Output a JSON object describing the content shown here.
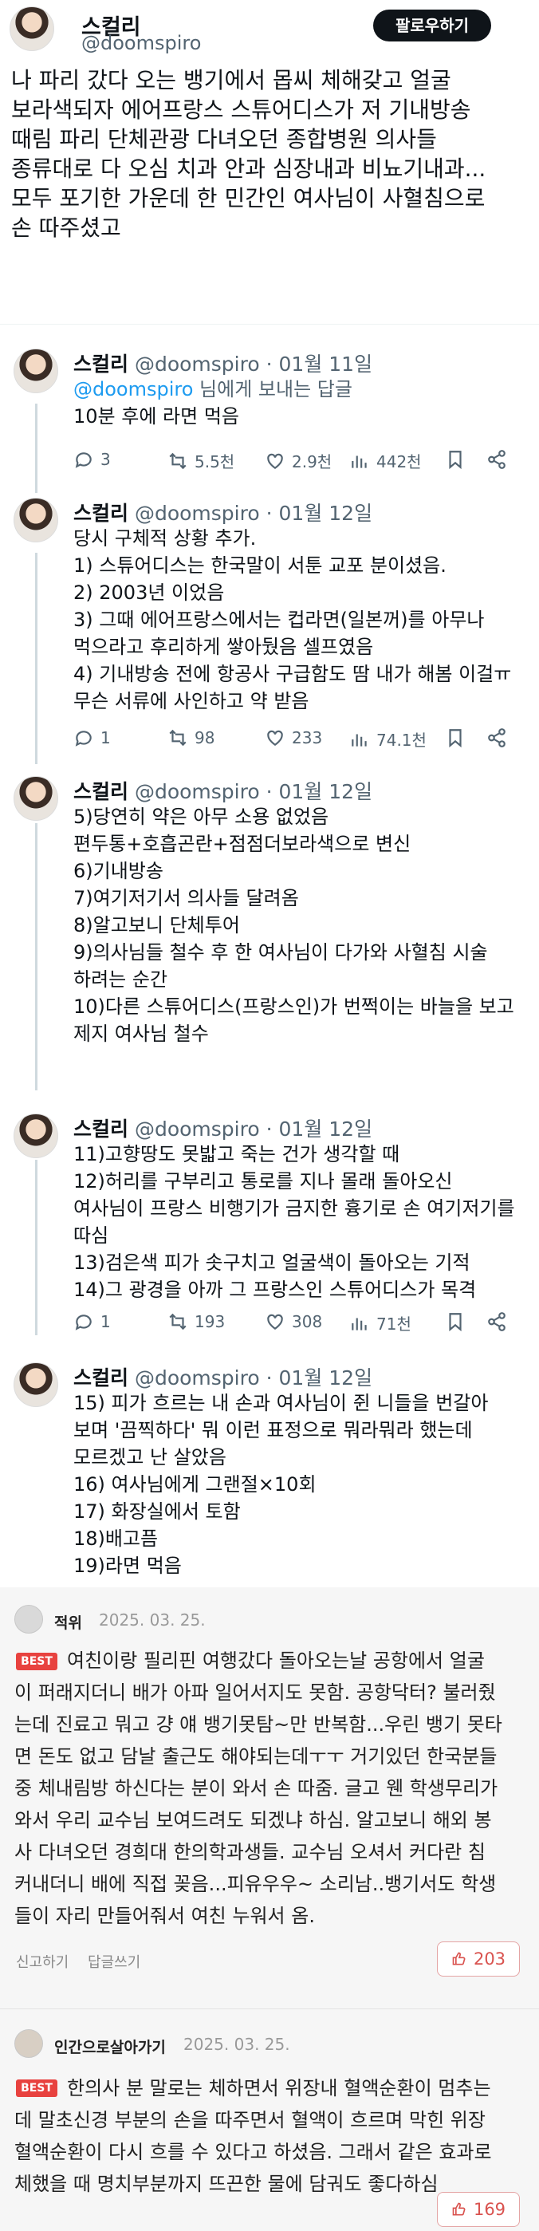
{
  "main_tweet": {
    "name": "스컬리",
    "handle": "@doomspiro",
    "follow_label": "팔로우하기",
    "text": "나 파리 갔다 오는 뱅기에서 몹씨 체해갖고 얼굴\n보라색되자 에어프랑스 스튜어디스가 저 기내방송\n때림 파리 단체관광 다녀오던 종합병원 의사들\n종류대로 다 오심 치과 안과 심장내과 비뇨기내과...\n모두 포기한 가운데 한 민간인 여사님이 사혈침으로\n손 따주셨고"
  },
  "replies": [
    {
      "name": "스컬리",
      "handle": "@doomspiro",
      "date": "· 01월 11일",
      "replying_mention": "@doomspiro",
      "replying_suffix": " 님에게 보내는 답글",
      "text": "10분 후에 라면 먹음",
      "stats": {
        "replies": "3",
        "retweets": "5.5천",
        "likes": "2.9천",
        "views": "442천"
      }
    },
    {
      "name": "스컬리",
      "handle": "@doomspiro",
      "date": "· 01월 12일",
      "text": "당시 구체적 상황 추가.\n1) 스튜어디스는 한국말이 서툰 교포 분이셨음.\n2) 2003년 이었음\n3) 그때 에어프랑스에서는 컵라면(일본꺼)를 아무나\n먹으라고 후리하게 쌓아뒀음 셀프였음\n4) 기내방송 전에 항공사 구급함도 땀 내가 해봄 이걸ㅠ\n무슨 서류에 사인하고 약 받음",
      "stats": {
        "replies": "1",
        "retweets": "98",
        "likes": "233",
        "views": "74.1천"
      }
    },
    {
      "name": "스컬리",
      "handle": "@doomspiro",
      "date": "· 01월 12일",
      "text": "5)당연히 약은 아무 소용 없었음\n편두통+호흡곤란+점점더보라색으로 변신\n6)기내방송\n7)여기저기서 의사들 달려옴\n8)알고보니 단체투어\n9)의사님들 철수 후 한 여사님이 다가와 사혈침 시술\n하려는 순간\n10)다른 스튜어디스(프랑스인)가 번쩍이는 바늘을 보고\n제지 여사님 철수"
    },
    {
      "name": "스컬리",
      "handle": "@doomspiro",
      "date": "· 01월 12일",
      "text": "11)고향땅도 못밟고 죽는 건가 생각할 때\n12)허리를 구부리고 통로를 지나 몰래 돌아오신\n여사님이 프랑스 비행기가 금지한 흉기로 손 여기저기를\n따심\n13)검은색 피가 솟구치고 얼굴색이 돌아오는 기적\n14)그 광경을 아까 그 프랑스인 스튜어디스가 목격",
      "stats": {
        "replies": "1",
        "retweets": "193",
        "likes": "308",
        "views": "71천"
      }
    },
    {
      "name": "스컬리",
      "handle": "@doomspiro",
      "date": "· 01월 12일",
      "text": "15) 피가 흐르는 내 손과 여사님이 쥔 니들을 번갈아\n보며 '끔찍하다' 뭐 이런 표정으로 뭐라뭐라 했는데\n모르겠고 난 살았음\n16) 여사님에게 그랜절×10회\n17) 화장실에서 토함\n18)배고픔\n19)라면 먹음"
    }
  ],
  "comments": [
    {
      "name": "적위",
      "date": "2025. 03. 25.",
      "badge": "BEST",
      "text": "여친이랑 필리핀 여행갔다 돌아오는날 공항에서 얼굴\n이 퍼래지더니 배가 아파 일어서지도 못함. 공항닥터? 불러줬\n는데 진료고 뭐고 걍 얘 뱅기못탐~만 반복함...우린 뱅기 못타\n면 돈도 없고 담날 출근도 해야되는데ㅜㅜ 거기있던 한국분들\n중 체내림방 하신다는 분이 와서 손 따줌. 글고 웬 학생무리가\n와서 우리 교수님 보여드려도 되겠냐 하심. 알고보니 해외 봉\n사 다녀오던 경희대 한의학과생들. 교수님 오셔서 커다란 침\n커내더니 배에 직접 꽂음...피유우우~ 소리남..뱅기서도 학생\n들이 자리 만들어줘서 여친 누워서 옴.",
      "report_label": "신고하기",
      "reply_label": "답글쓰기",
      "likes": "203"
    },
    {
      "name": "인간으로살아가기",
      "date": "2025. 03. 25.",
      "badge": "BEST",
      "text": "한의사 분 말로는 체하면서 위장내 혈액순환이 멈추는\n데 말초신경 부분의 손을 따주면서 혈액이 흐르며 막힌 위장\n혈액순환이 다시 흐를 수 있다고 하셨음. 그래서 같은 효과로\n체했을 때 명치부분까지 뜨끈한 물에 담궈도 좋다하심",
      "likes": "169"
    }
  ]
}
